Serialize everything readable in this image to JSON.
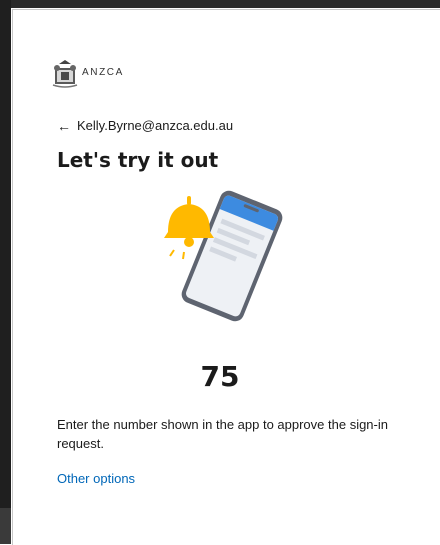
{
  "org": {
    "logo_text": "ANZCA",
    "logo_icon": "crest-icon"
  },
  "signin": {
    "back_icon": "back-arrow-icon",
    "email": "Kelly.Byrne@anzca.edu.au",
    "title": "Let's try it out",
    "number": "75",
    "instruction": "Enter the number shown in the app to approve the sign-in request.",
    "other_options": "Other options"
  },
  "colors": {
    "link": "#0067b8",
    "bell": "#ffb900",
    "phone_header": "#3d8be0",
    "phone_frame": "#5e6470"
  }
}
